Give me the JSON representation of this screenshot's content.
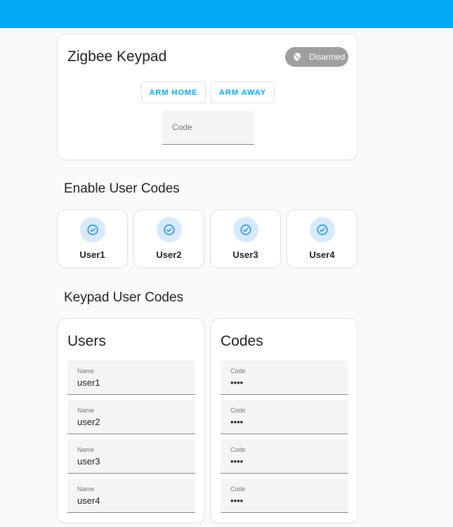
{
  "header": {
    "color": "#03a9f4"
  },
  "keypad": {
    "title": "Zigbee Keypad",
    "status": "Disarmed",
    "arm_home": "ARM HOME",
    "arm_away": "ARM AWAY",
    "code_placeholder": "Code"
  },
  "enable": {
    "heading": "Enable User Codes",
    "users": [
      {
        "label": "User1"
      },
      {
        "label": "User2"
      },
      {
        "label": "User3"
      },
      {
        "label": "User4"
      }
    ]
  },
  "codes_section": {
    "heading": "Keypad User Codes",
    "users_card": {
      "title": "Users",
      "field_label": "Name",
      "values": [
        "user1",
        "user2",
        "user3",
        "user4"
      ]
    },
    "codes_card": {
      "title": "Codes",
      "field_label": "Code",
      "values": [
        "••••",
        "••••",
        "••••",
        "••••"
      ]
    }
  }
}
